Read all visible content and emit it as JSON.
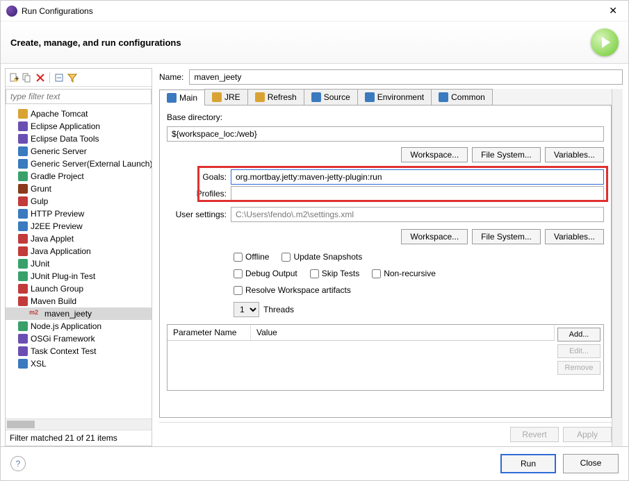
{
  "window": {
    "title": "Run Configurations"
  },
  "header": {
    "title": "Create, manage, and run configurations"
  },
  "filter": {
    "placeholder": "type filter text"
  },
  "tree": {
    "items": [
      {
        "label": "Apache Tomcat",
        "color": "#d9a334"
      },
      {
        "label": "Eclipse Application",
        "color": "#6a4fb3"
      },
      {
        "label": "Eclipse Data Tools",
        "color": "#6a4fb3"
      },
      {
        "label": "Generic Server",
        "color": "#3a7abf"
      },
      {
        "label": "Generic Server(External Launch)",
        "color": "#3a7abf"
      },
      {
        "label": "Gradle Project",
        "color": "#3aa06a"
      },
      {
        "label": "Grunt",
        "color": "#8a3a1a"
      },
      {
        "label": "Gulp",
        "color": "#c23a3a"
      },
      {
        "label": "HTTP Preview",
        "color": "#3a7abf"
      },
      {
        "label": "J2EE Preview",
        "color": "#3a7abf"
      },
      {
        "label": "Java Applet",
        "color": "#c23a3a"
      },
      {
        "label": "Java Application",
        "color": "#c23a3a"
      },
      {
        "label": "JUnit",
        "color": "#3aa06a"
      },
      {
        "label": "JUnit Plug-in Test",
        "color": "#3aa06a"
      },
      {
        "label": "Launch Group",
        "color": "#c23a3a"
      },
      {
        "label": "Maven Build",
        "color": "#c23a3a",
        "expanded": true
      },
      {
        "label": "maven_jeety",
        "color": "#c23a3a",
        "child": true,
        "selected": true,
        "prefix": "m2"
      },
      {
        "label": "Node.js Application",
        "color": "#3aa06a"
      },
      {
        "label": "OSGi Framework",
        "color": "#6a4fb3"
      },
      {
        "label": "Task Context Test",
        "color": "#6a4fb3"
      },
      {
        "label": "XSL",
        "color": "#3a7abf"
      }
    ]
  },
  "status": "Filter matched 21 of 21 items",
  "form": {
    "name_label": "Name:",
    "name_value": "maven_jeety",
    "tabs": [
      "Main",
      "JRE",
      "Refresh",
      "Source",
      "Environment",
      "Common"
    ],
    "base_dir_label": "Base directory:",
    "base_dir_value": "${workspace_loc:/web}",
    "workspace_btn": "Workspace...",
    "filesystem_btn": "File System...",
    "variables_btn": "Variables...",
    "goals_label": "Goals:",
    "goals_value": "org.mortbay.jetty:maven-jetty-plugin:run",
    "profiles_label": "Profiles:",
    "profiles_value": "",
    "usersettings_label": "User settings:",
    "usersettings_value": "C:\\Users\\fendo\\.m2\\settings.xml",
    "checks": {
      "offline": "Offline",
      "update": "Update Snapshots",
      "debug": "Debug Output",
      "skip": "Skip Tests",
      "nonrec": "Non-recursive",
      "resolve": "Resolve Workspace artifacts"
    },
    "threads_value": "1",
    "threads_label": "Threads",
    "param_name": "Parameter Name",
    "param_value": "Value",
    "add": "Add...",
    "edit": "Edit...",
    "remove": "Remove",
    "revert": "Revert",
    "apply": "Apply"
  },
  "footer": {
    "run": "Run",
    "close": "Close"
  }
}
